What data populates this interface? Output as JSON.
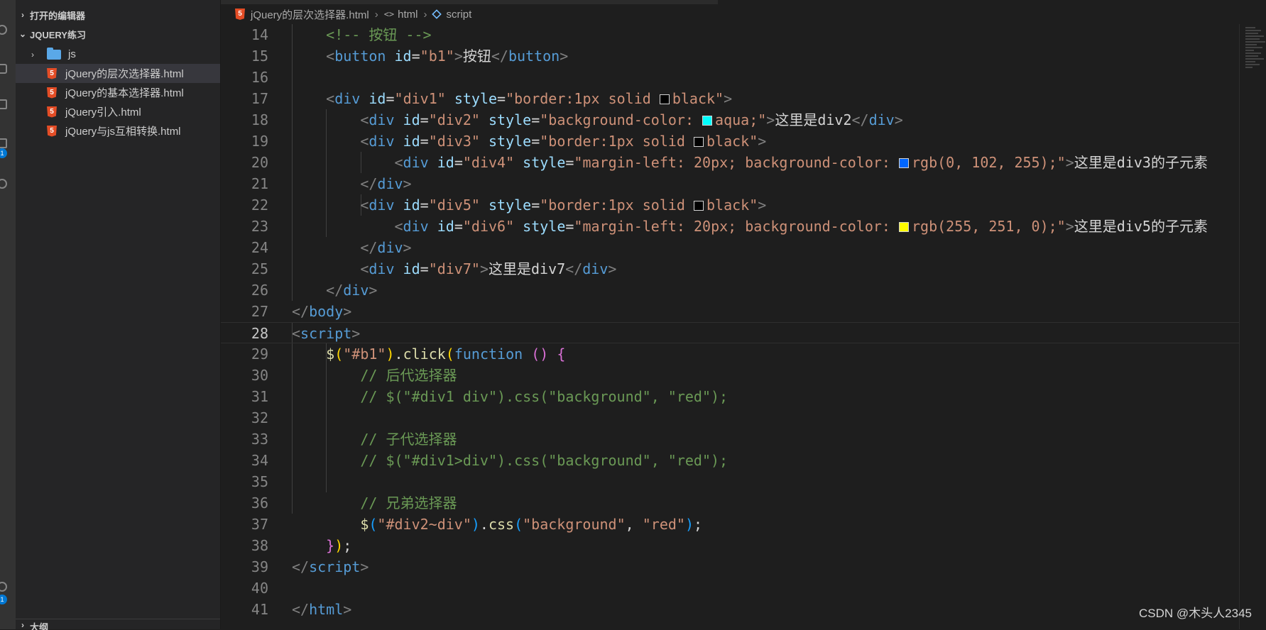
{
  "sidebar": {
    "open_editors_label": "打开的编辑器",
    "workspace_label": "JQUERY练习",
    "outline_label": "大纲",
    "items": [
      {
        "label": "js",
        "type": "folder"
      },
      {
        "label": "jQuery的层次选择器.html",
        "type": "html",
        "active": true
      },
      {
        "label": "jQuery的基本选择器.html",
        "type": "html"
      },
      {
        "label": "jQuery引入.html",
        "type": "html"
      },
      {
        "label": "jQuery与js互相转换.html",
        "type": "html"
      }
    ]
  },
  "breadcrumb": {
    "file": "jQuery的层次选择器.html",
    "element1": "html",
    "element2": "script"
  },
  "activity_badges": [
    "1",
    "1"
  ],
  "editor": {
    "current_line": "28",
    "line_numbers": [
      "14",
      "15",
      "16",
      "17",
      "18",
      "19",
      "20",
      "21",
      "22",
      "23",
      "24",
      "25",
      "26",
      "27",
      "28",
      "29",
      "30",
      "31",
      "32",
      "33",
      "34",
      "35",
      "36",
      "37",
      "38",
      "39",
      "40",
      "41"
    ]
  },
  "colors": {
    "aqua": "#00ffff",
    "blue": "#0066ff",
    "yellow": "#fffb00",
    "black": "#000000"
  },
  "watermark": "CSDN @木头人2345"
}
